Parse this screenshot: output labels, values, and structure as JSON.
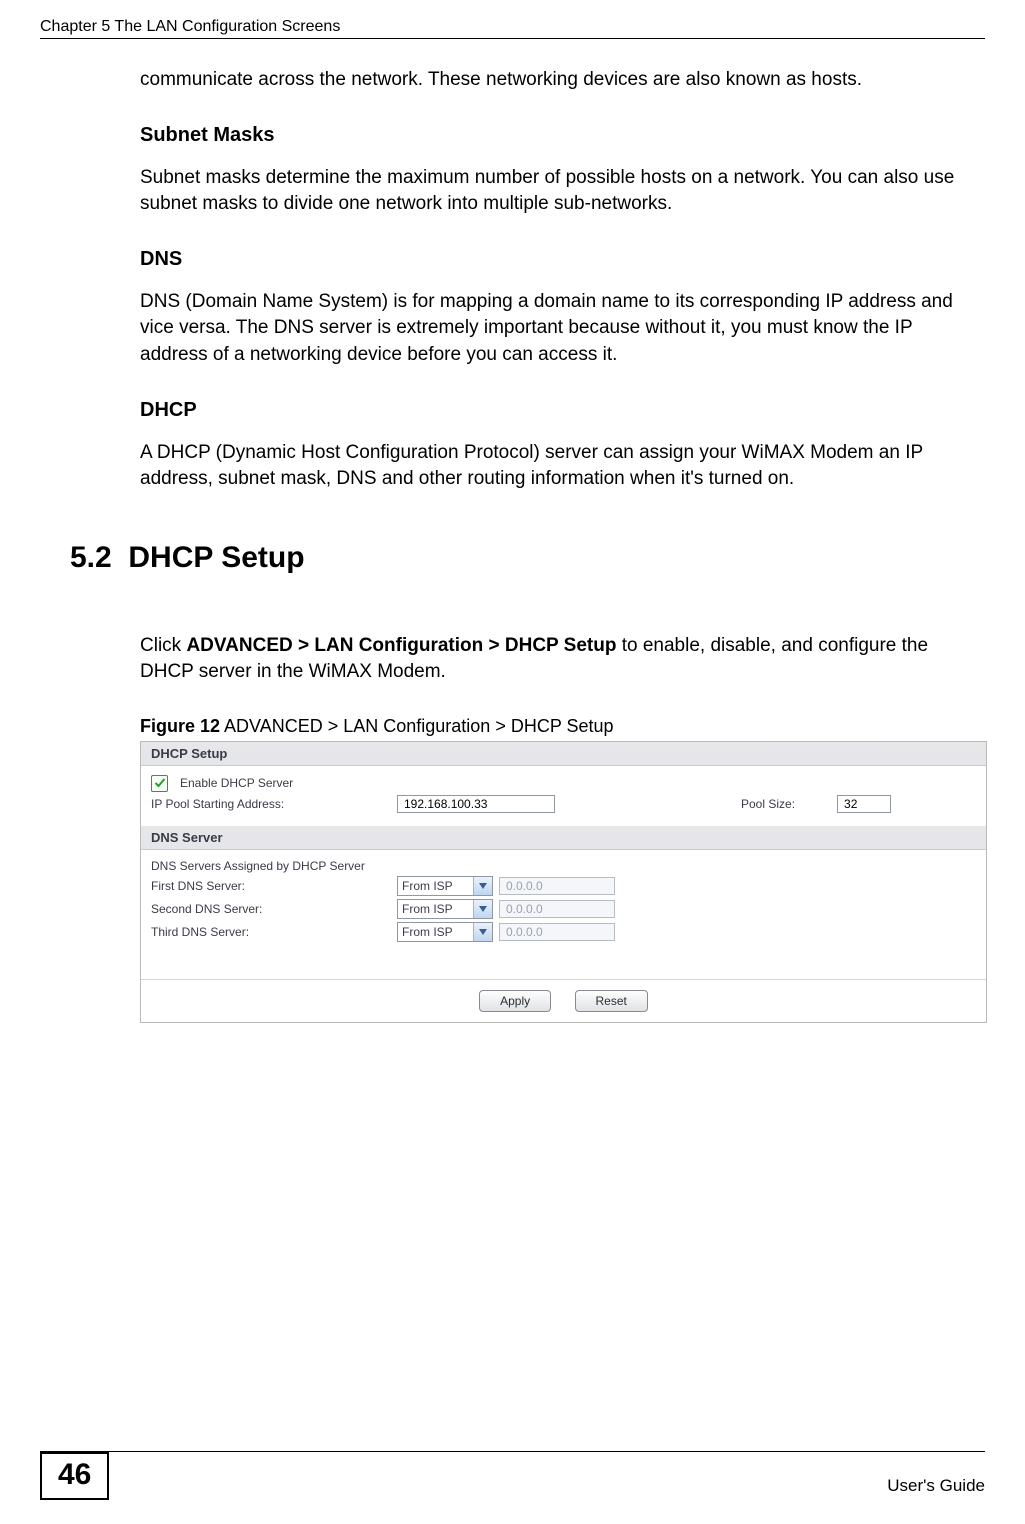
{
  "header": {
    "chapter": "Chapter 5 The LAN Configuration Screens"
  },
  "intro_tail": "communicate across the network. These networking devices are also known as hosts.",
  "subnet": {
    "heading": "Subnet Masks",
    "body": "Subnet masks determine the maximum number of possible hosts on a network. You can also use subnet masks to divide one network into multiple sub-networks."
  },
  "dns": {
    "heading": "DNS",
    "body": "DNS (Domain Name System) is for mapping a domain name to its corresponding IP address and vice versa. The DNS server is extremely important because without it, you must know the IP address of a networking device before you can access it."
  },
  "dhcp_para": {
    "heading": "DHCP",
    "body": "A DHCP (Dynamic Host Configuration Protocol) server can assign your WiMAX Modem an IP address, subnet mask, DNS and other routing information when it's turned on."
  },
  "section": {
    "number": "5.2",
    "title": "DHCP Setup",
    "lead_prefix": "Click ",
    "lead_bold": "ADVANCED > LAN Configuration > DHCP Setup",
    "lead_suffix": " to enable, disable, and configure the DHCP server in the WiMAX Modem."
  },
  "figure": {
    "label": "Figure 12",
    "caption_suffix": "   ADVANCED > LAN Configuration > DHCP Setup"
  },
  "fig_panel": {
    "dhcp_setup": {
      "title": "DHCP Setup",
      "enable_label": "Enable DHCP Server",
      "ip_pool_label": "IP Pool Starting Address:",
      "ip_pool_value": "192.168.100.33",
      "pool_size_label": "Pool Size:",
      "pool_size_value": "32"
    },
    "dns_server": {
      "title": "DNS Server",
      "assigned_label": "DNS Servers Assigned by DHCP Server",
      "first_label": "First DNS Server:",
      "second_label": "Second DNS Server:",
      "third_label": "Third DNS Server:",
      "select_value": "From ISP",
      "ip_placeholder": "0.0.0.0"
    },
    "buttons": {
      "apply": "Apply",
      "reset": "Reset"
    }
  },
  "footer": {
    "page": "46",
    "guide": "User's Guide"
  }
}
